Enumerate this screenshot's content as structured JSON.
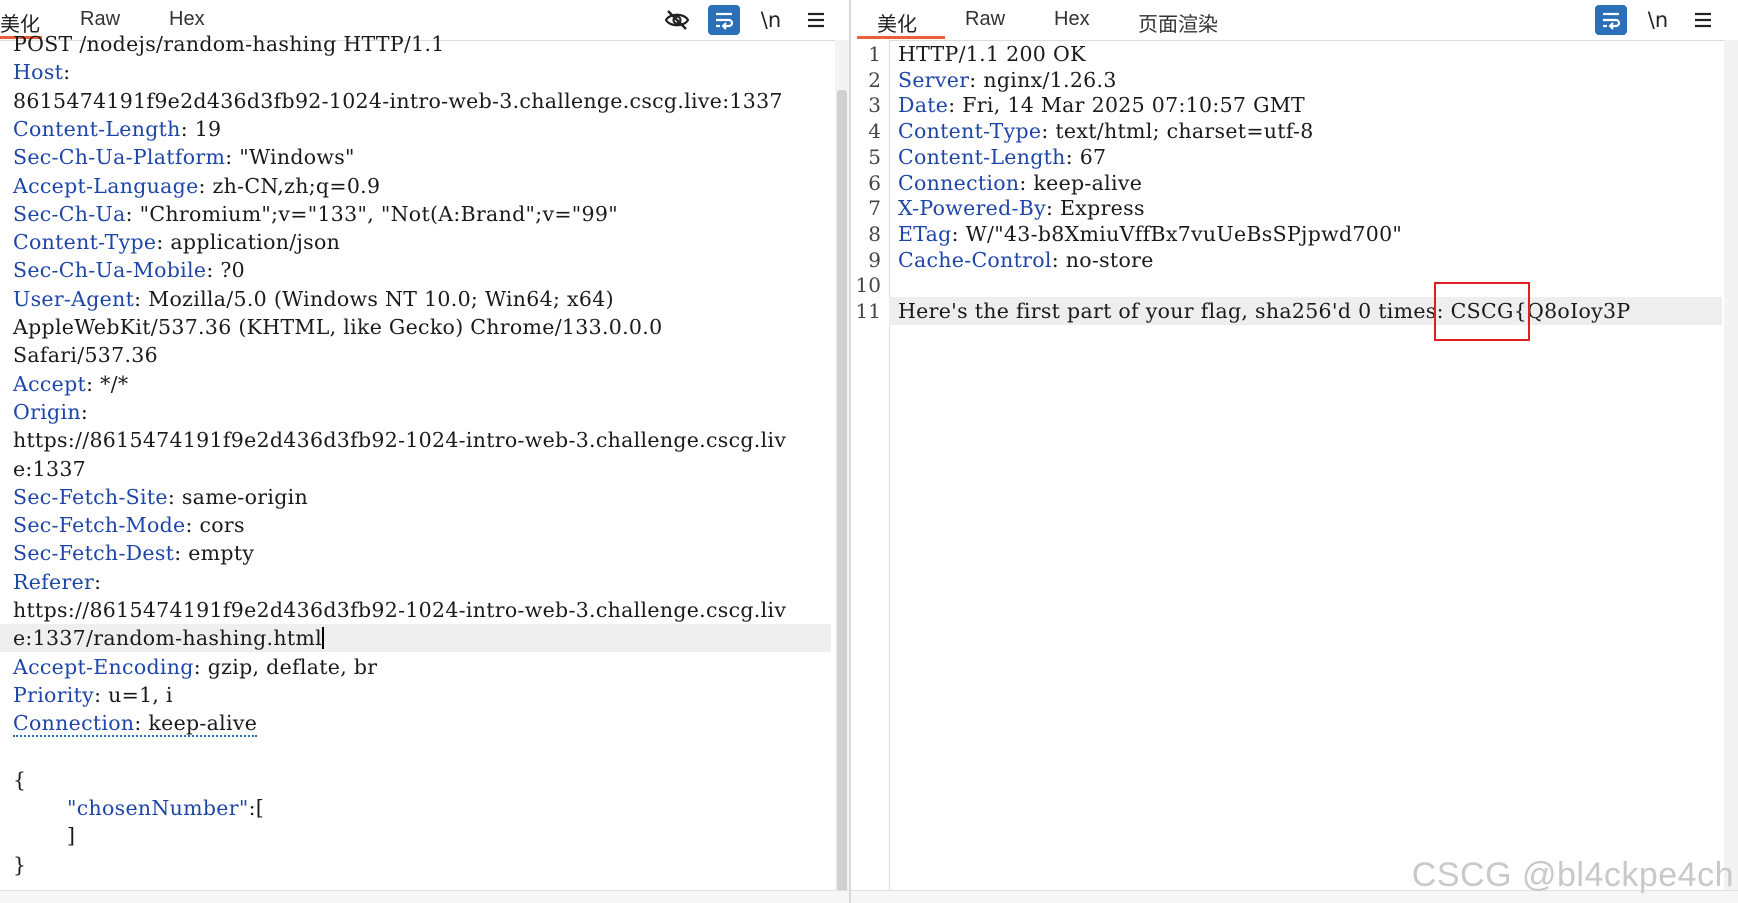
{
  "request_pane": {
    "tabs": [
      "美化",
      "Raw",
      "Hex"
    ],
    "lines": [
      {
        "v": "POST /nodejs/random-hashing HTTP/1.1"
      },
      {
        "k": "Host",
        "v": ":"
      },
      {
        "v": "8615474191f9e2d436d3fb92-1024-intro-web-3.challenge.cscg.live:1337"
      },
      {
        "k": "Content-Length",
        "v": ": 19"
      },
      {
        "k": "Sec-Ch-Ua-Platform",
        "v": ": \"Windows\""
      },
      {
        "k": "Accept-Language",
        "v": ": zh-CN,zh;q=0.9"
      },
      {
        "k": "Sec-Ch-Ua",
        "v": ": \"Chromium\";v=\"133\", \"Not(A:Brand\";v=\"99\""
      },
      {
        "k": "Content-Type",
        "v": ": application/json"
      },
      {
        "k": "Sec-Ch-Ua-Mobile",
        "v": ": ?0"
      },
      {
        "k": "User-Agent",
        "v": ": Mozilla/5.0 (Windows NT 10.0; Win64; x64)"
      },
      {
        "v": "AppleWebKit/537.36 (KHTML, like Gecko) Chrome/133.0.0.0"
      },
      {
        "v": "Safari/537.36"
      },
      {
        "k": "Accept",
        "v": ": */*"
      },
      {
        "k": "Origin",
        "v": ":"
      },
      {
        "v": "https://8615474191f9e2d436d3fb92-1024-intro-web-3.challenge.cscg.liv"
      },
      {
        "v": "e:1337"
      },
      {
        "k": "Sec-Fetch-Site",
        "v": ": same-origin"
      },
      {
        "k": "Sec-Fetch-Mode",
        "v": ": cors"
      },
      {
        "k": "Sec-Fetch-Dest",
        "v": ": empty"
      },
      {
        "k": "Referer",
        "v": ":"
      },
      {
        "v": "https://8615474191f9e2d436d3fb92-1024-intro-web-3.challenge.cscg.liv"
      },
      {
        "v": "e:1337/random-hashing.html",
        "cursor": true,
        "highlight": true
      },
      {
        "k": "Accept-Encoding",
        "v": ": gzip, deflate, br"
      },
      {
        "k": "Priority",
        "v": ": u=1, i"
      },
      {
        "k": "Connection",
        "v": ": keep-alive",
        "dotted": true
      },
      {
        "v": ""
      },
      {
        "v": "{"
      },
      {
        "json_key": "\"chosenNumber\"",
        "v": ":[",
        "indent": true
      },
      {
        "v": "]",
        "indent": true
      },
      {
        "v": "}"
      }
    ]
  },
  "response_pane": {
    "tabs": [
      "美化",
      "Raw",
      "Hex",
      "页面渲染"
    ],
    "lines": [
      {
        "n": "1",
        "v": "HTTP/1.1 200 OK"
      },
      {
        "n": "2",
        "k": "Server",
        "v": ": nginx/1.26.3"
      },
      {
        "n": "3",
        "k": "Date",
        "v": ": Fri, 14 Mar 2025 07:10:57 GMT"
      },
      {
        "n": "4",
        "k": "Content-Type",
        "v": ": text/html; charset=utf-8"
      },
      {
        "n": "5",
        "k": "Content-Length",
        "v": ": 67"
      },
      {
        "n": "6",
        "k": "Connection",
        "v": ": keep-alive"
      },
      {
        "n": "7",
        "k": "X-Powered-By",
        "v": ": Express"
      },
      {
        "n": "8",
        "k": "ETag",
        "v": ": W/\"43-b8XmiuVffBx7vuUeBsSPjpwd700\""
      },
      {
        "n": "9",
        "k": "Cache-Control",
        "v": ": no-store"
      },
      {
        "n": "10",
        "v": ""
      },
      {
        "n": "11",
        "v": "Here's the first part of your flag, sha256'd 0 times: CSCG{Q8oIoy3P",
        "highlight": true
      }
    ]
  },
  "watermark": "CSCG @bl4ckpe4ch",
  "colors": {
    "header_key": "#1e46a8",
    "tab_accent": "#e8613a",
    "tool_blue": "#2a6fb8",
    "redbox": "#e02020"
  }
}
